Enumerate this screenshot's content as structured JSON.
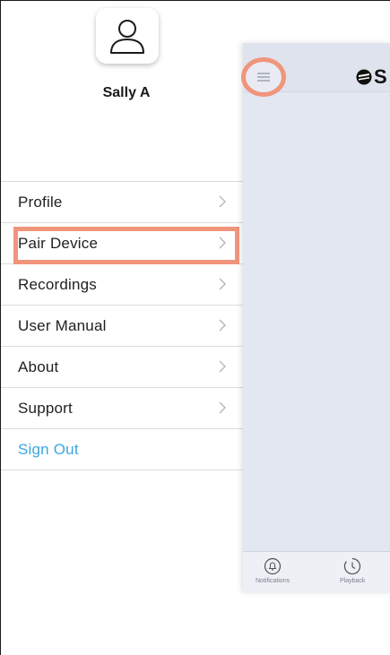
{
  "profile": {
    "name": "Sally A",
    "avatar_icon": "user-outline-icon"
  },
  "menu": {
    "items": [
      {
        "label": "Profile",
        "icon": "chevron-right-icon"
      },
      {
        "label": "Pair Device",
        "icon": "chevron-right-icon"
      },
      {
        "label": "Recordings",
        "icon": "chevron-right-icon"
      },
      {
        "label": "User Manual",
        "icon": "chevron-right-icon"
      },
      {
        "label": "About",
        "icon": "chevron-right-icon"
      },
      {
        "label": "Support",
        "icon": "chevron-right-icon"
      }
    ],
    "sign_out": "Sign Out",
    "highlighted_item": "Pair Device"
  },
  "app_preview": {
    "brand_letter": "S",
    "menu_icon": "hamburger-icon",
    "tabs": [
      {
        "label": "Notifications",
        "icon": "bell-icon"
      },
      {
        "label": "Playback",
        "icon": "clock-icon"
      }
    ]
  },
  "colors": {
    "highlight": "#f0957b",
    "sign_out": "#3aa8e0",
    "app_background": "#e3e7f2"
  }
}
